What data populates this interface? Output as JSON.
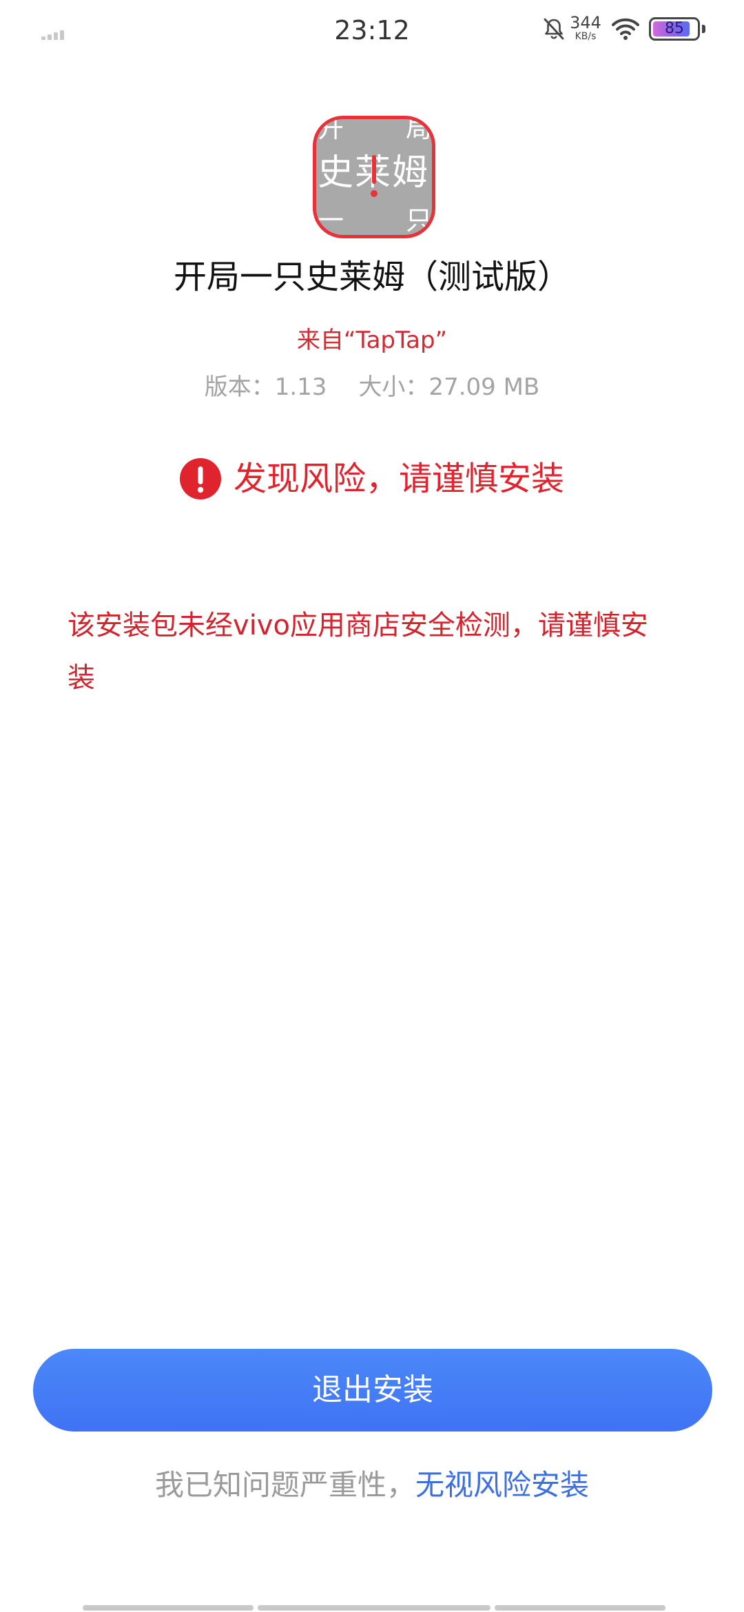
{
  "status_bar": {
    "time": "23:12",
    "net_speed": "344",
    "net_speed_unit": "KB/s",
    "battery_level": "85",
    "battery_fraction": 0.85,
    "icons": [
      "signal-icon",
      "bell-off-icon",
      "wifi-icon",
      "battery-icon"
    ]
  },
  "app": {
    "icon_text": [
      "开",
      "局",
      "史",
      "莱",
      "姆",
      "一",
      "只"
    ],
    "name": "开局一只史莱姆（测试版）",
    "source": "来自“TapTap”",
    "version": "版本：1.13",
    "size": "大小：27.09 MB"
  },
  "risk": {
    "icon": "alert-circle-icon",
    "title": "发现风险，请谨慎安装",
    "description": "该安装包未经vivo应用商店安全检测，请谨慎安装"
  },
  "actions": {
    "exit_label": "退出安装",
    "ignore_prefix": "我已知问题严重性，",
    "ignore_link": "无视风险安装"
  },
  "colors": {
    "danger": "#e0242e",
    "primary": "#4280f6",
    "link": "#3d6fe0",
    "muted": "#a3a3a3"
  }
}
